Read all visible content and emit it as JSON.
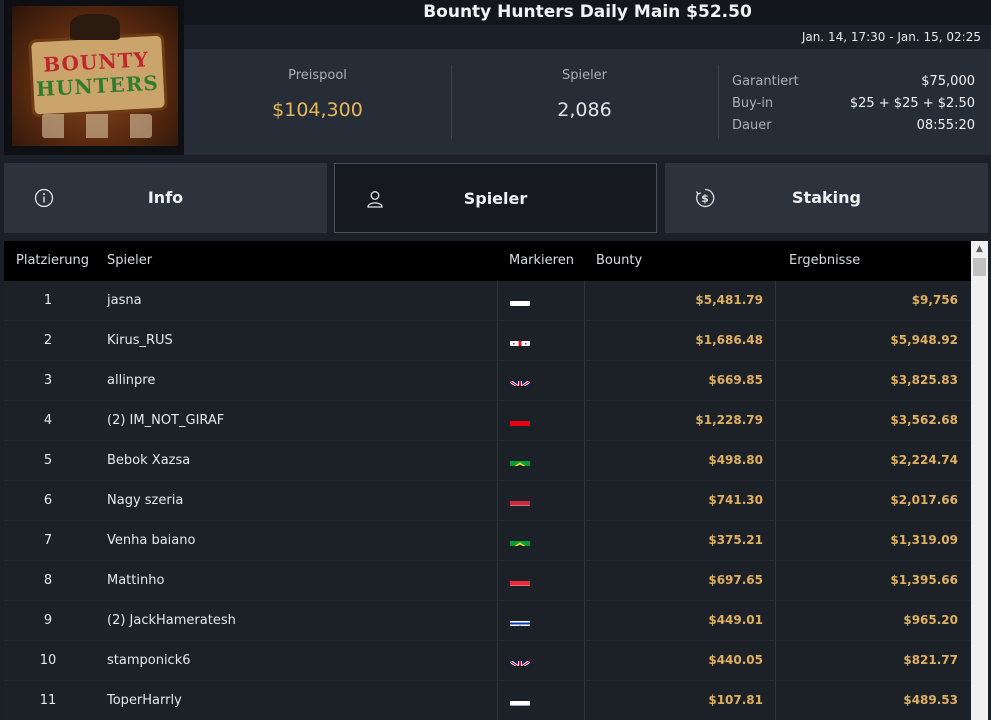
{
  "logo": {
    "line1": "BOUNTY",
    "line2": "HUNTERS"
  },
  "title": "Bounty Hunters Daily Main $52.50",
  "date_range": "Jan. 14, 17:30 - Jan. 15, 02:25",
  "stats": {
    "prize_pool_label": "Preispool",
    "prize_pool_value": "$104,300",
    "players_label": "Spieler",
    "players_value": "2,086",
    "guaranteed_label": "Garantiert",
    "guaranteed_value": "$75,000",
    "buyin_label": "Buy-in",
    "buyin_value": "$25 + $25 + $2.50",
    "duration_label": "Dauer",
    "duration_value": "08:55:20"
  },
  "tabs": [
    {
      "label": "Info",
      "icon": "info-circle-icon"
    },
    {
      "label": "Spieler",
      "icon": "user-icon",
      "active": true
    },
    {
      "label": "Staking",
      "icon": "dollar-cycle-icon"
    }
  ],
  "table": {
    "headers": [
      "Platzierung",
      "Spieler",
      "Markieren",
      "Bounty",
      "Ergebnisse"
    ],
    "rows": [
      {
        "rank": "1",
        "name": "jasna",
        "flag": "poland",
        "bounty": "$5,481.79",
        "result": "$9,756"
      },
      {
        "rank": "2",
        "name": "Kirus_RUS",
        "flag": "georgia",
        "bounty": "$1,686.48",
        "result": "$5,948.92"
      },
      {
        "rank": "3",
        "name": "allinpre",
        "flag": "united-kingdom",
        "bounty": "$669.85",
        "result": "$3,825.83"
      },
      {
        "rank": "4",
        "name": "(2) IM_NOT_GIRAF",
        "flag": "indonesia",
        "bounty": "$1,228.79",
        "result": "$3,562.68"
      },
      {
        "rank": "5",
        "name": "Bebok Xazsa",
        "flag": "brazil",
        "bounty": "$498.80",
        "result": "$2,224.74"
      },
      {
        "rank": "6",
        "name": "Nagy szeria",
        "flag": "hungary",
        "bounty": "$741.30",
        "result": "$2,017.66"
      },
      {
        "rank": "7",
        "name": "Venha baiano",
        "flag": "brazil",
        "bounty": "$375.21",
        "result": "$1,319.09"
      },
      {
        "rank": "8",
        "name": "Mattinho",
        "flag": "austria",
        "bounty": "$697.65",
        "result": "$1,395.66"
      },
      {
        "rank": "9",
        "name": "(2) JackHameratesh",
        "flag": "israel",
        "bounty": "$449.01",
        "result": "$965.20"
      },
      {
        "rank": "10",
        "name": "stamponick6",
        "flag": "united-kingdom",
        "bounty": "$440.05",
        "result": "$821.77"
      },
      {
        "rank": "11",
        "name": "ToperHarrly",
        "flag": "russia",
        "bounty": "$107.81",
        "result": "$489.53"
      }
    ]
  },
  "colors": {
    "accent_gold": "#e0b060",
    "background": "#1b2028",
    "panel": "#272d36",
    "active_tab": "#161a20"
  }
}
